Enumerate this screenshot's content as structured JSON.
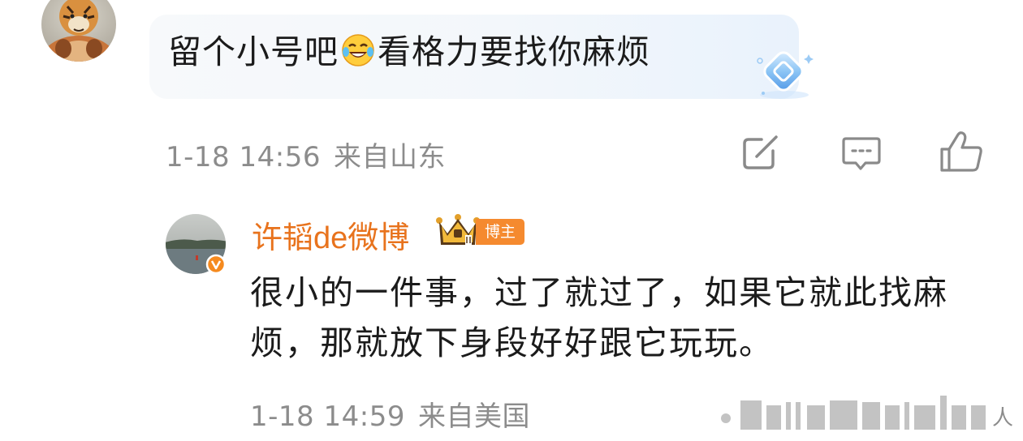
{
  "comment": {
    "text_before_emoji": "留个小号吧",
    "emoji": "laugh-cry-emoji",
    "text_after_emoji": "看格力要找你麻烦",
    "time": "1-18 14:56",
    "location": "来自山东"
  },
  "reply": {
    "username": "许韬de微博",
    "badge": "博主",
    "text": "很小的一件事，过了就过了，如果它就此找麻烦，那就放下身段好好跟它玩玩。",
    "time": "1-18 14:59",
    "location": "来自美国"
  },
  "watermark": {
    "text": "人"
  },
  "colors": {
    "username": "#e8731d",
    "meta": "#8c8c8c",
    "badge": "#f58a2f",
    "text": "#1b1b1b"
  }
}
